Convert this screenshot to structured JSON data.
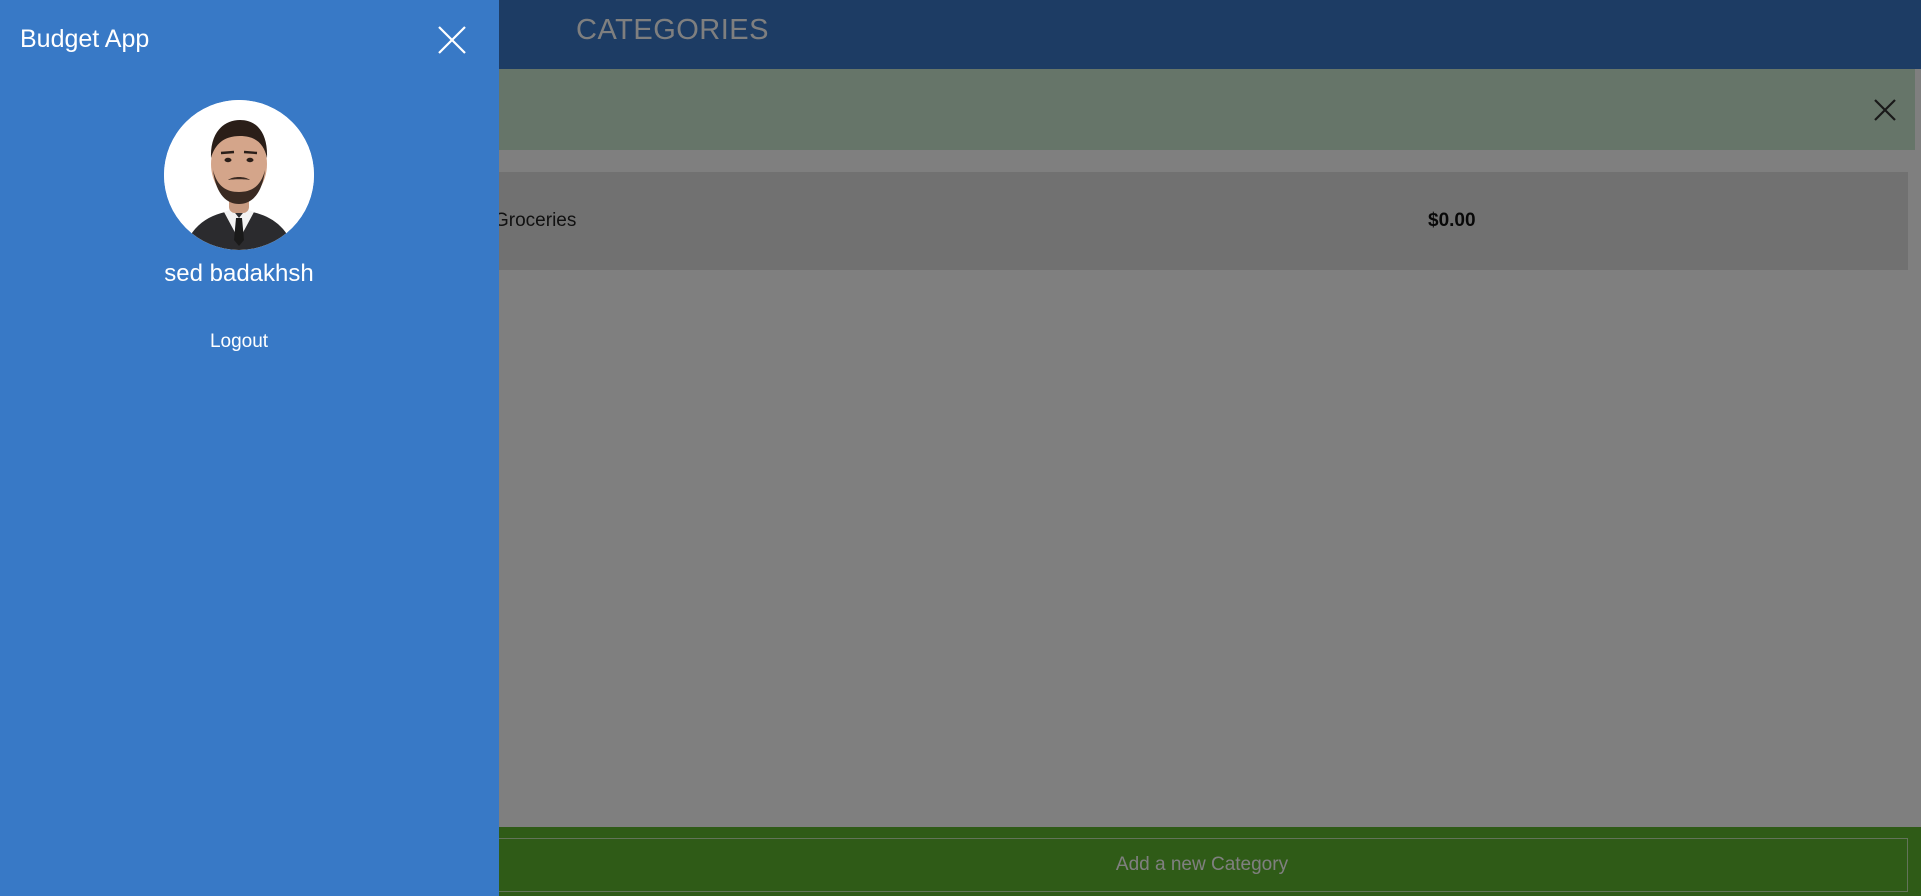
{
  "page": {
    "header": {
      "title": "CATEGORIES"
    },
    "categories": [
      {
        "name": "Groceries",
        "amount": "$0.00"
      }
    ],
    "footer": {
      "add_category_label": "Add a new Category"
    }
  },
  "drawer": {
    "app_title": "Budget App",
    "user": {
      "name": "sed badakhsh"
    },
    "logout_label": "Logout"
  },
  "colors": {
    "header_bg": "#3a78c8",
    "drawer_bg": "#3879c6",
    "notice_bg": "#cdebd3",
    "footer_bg": "#5fb72f",
    "row_bg": "#e3e3e3"
  },
  "icons": {
    "drawer_close": "close-icon",
    "notice_close": "close-icon",
    "avatar": "user-avatar"
  }
}
